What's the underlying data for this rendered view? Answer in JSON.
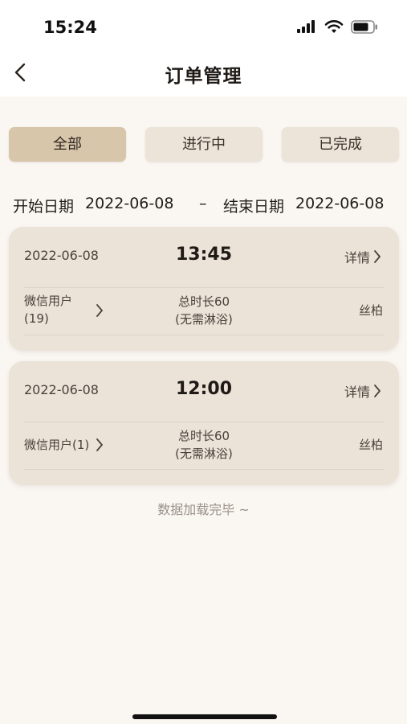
{
  "status_bar": {
    "time": "15:24"
  },
  "nav": {
    "title": "订单管理"
  },
  "tabs": [
    {
      "label": "全部",
      "active": true
    },
    {
      "label": "进行中",
      "active": false
    },
    {
      "label": "已完成",
      "active": false
    }
  ],
  "date_range": {
    "start_label": "开始日期",
    "start_value": "2022-06-08",
    "separator": "–",
    "end_label": "结束日期",
    "end_value": "2022-06-08"
  },
  "orders": [
    {
      "date": "2022-06-08",
      "time": "13:45",
      "detail_label": "详情",
      "user_line1": "微信用户",
      "user_line2": "(19)",
      "duration_line1": "总时长60",
      "duration_line2": "(无需淋浴)",
      "staff": "丝柏"
    },
    {
      "date": "2022-06-08",
      "time": "12:00",
      "detail_label": "详情",
      "user_line1": "微信用户(1)",
      "duration_line1": "总时长60",
      "duration_line2": "(无需淋浴)",
      "staff": "丝柏"
    }
  ],
  "footer": {
    "load_done": "数据加载完毕 ~"
  },
  "colors": {
    "background": "#faf6f2",
    "card": "#ebe3d8",
    "tab_active": "#d8c6ab",
    "tab_inactive": "#ece4d9"
  }
}
